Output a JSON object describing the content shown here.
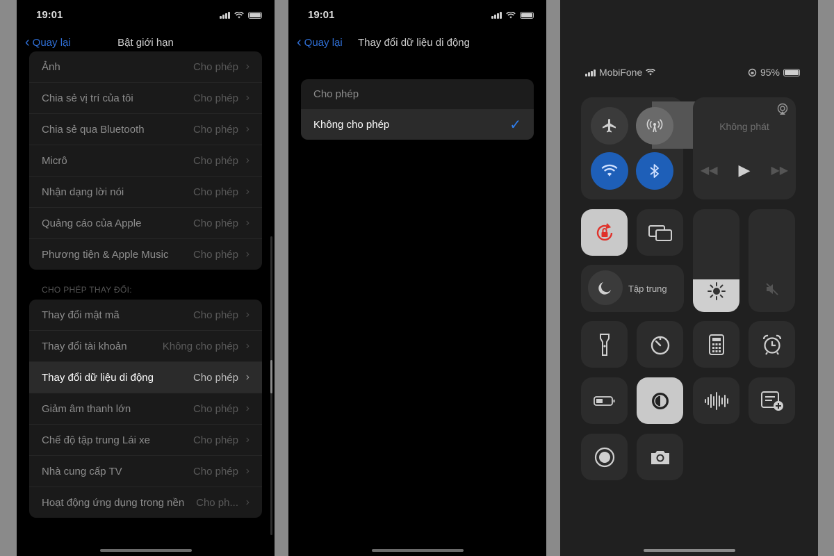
{
  "screen1": {
    "time": "19:01",
    "back_label": "Quay lại",
    "title": "Bật giới hạn",
    "group1": [
      {
        "label": "Ảnh",
        "value": "Cho phép"
      },
      {
        "label": "Chia sẻ vị trí của tôi",
        "value": "Cho phép"
      },
      {
        "label": "Chia sẻ qua Bluetooth",
        "value": "Cho phép"
      },
      {
        "label": "Micrô",
        "value": "Cho phép"
      },
      {
        "label": "Nhận dạng lời nói",
        "value": "Cho phép"
      },
      {
        "label": "Quảng cáo của Apple",
        "value": "Cho phép"
      },
      {
        "label": "Phương tiện & Apple Music",
        "value": "Cho phép"
      }
    ],
    "section_header": "CHO PHÉP THAY ĐỔI:",
    "group2": [
      {
        "label": "Thay đổi mật mã",
        "value": "Cho phép"
      },
      {
        "label": "Thay đổi tài khoản",
        "value": "Không cho phép"
      },
      {
        "label": "Thay đổi dữ liệu di động",
        "value": "Cho phép"
      },
      {
        "label": "Giảm âm thanh lớn",
        "value": "Cho phép"
      },
      {
        "label": "Chế độ tập trung Lái xe",
        "value": "Cho phép"
      },
      {
        "label": "Nhà cung cấp TV",
        "value": "Cho phép"
      },
      {
        "label": "Hoạt động ứng dụng trong nền",
        "value": "Cho ph..."
      }
    ]
  },
  "screen2": {
    "time": "19:01",
    "back_label": "Quay lại",
    "title": "Thay đổi dữ liệu di động",
    "options": [
      {
        "label": "Cho phép"
      },
      {
        "label": "Không cho phép"
      }
    ],
    "selected_index": 1,
    "check_mark": "✓"
  },
  "screen3": {
    "carrier": "MobiFone",
    "battery": "95%",
    "now_playing": "Không phát",
    "focus_label": "Tập trung",
    "brightness_level": 0.32,
    "volume_level": 0.0,
    "icons": {
      "airplane": "airplane-icon",
      "cellular": "cellular-data-icon",
      "wifi": "wifi-icon",
      "bluetooth": "bluetooth-icon",
      "airplay": "airplay-icon",
      "orientation_lock": "orientation-lock-icon",
      "screen_mirroring": "screen-mirroring-icon",
      "moon": "moon-icon",
      "brightness": "sun-icon",
      "mute": "speaker-mute-icon",
      "flashlight": "flashlight-icon",
      "timer": "timer-icon",
      "calculator": "calculator-icon",
      "alarm": "alarm-icon",
      "low_power": "battery-icon",
      "dark_mode": "dark-mode-icon",
      "voice_memo": "voice-memo-icon",
      "notes": "quick-note-icon",
      "screen_record": "screen-record-icon",
      "camera": "camera-icon"
    },
    "colors": {
      "accent": "#1e5fb8",
      "tile": "#2c2c2c"
    }
  }
}
